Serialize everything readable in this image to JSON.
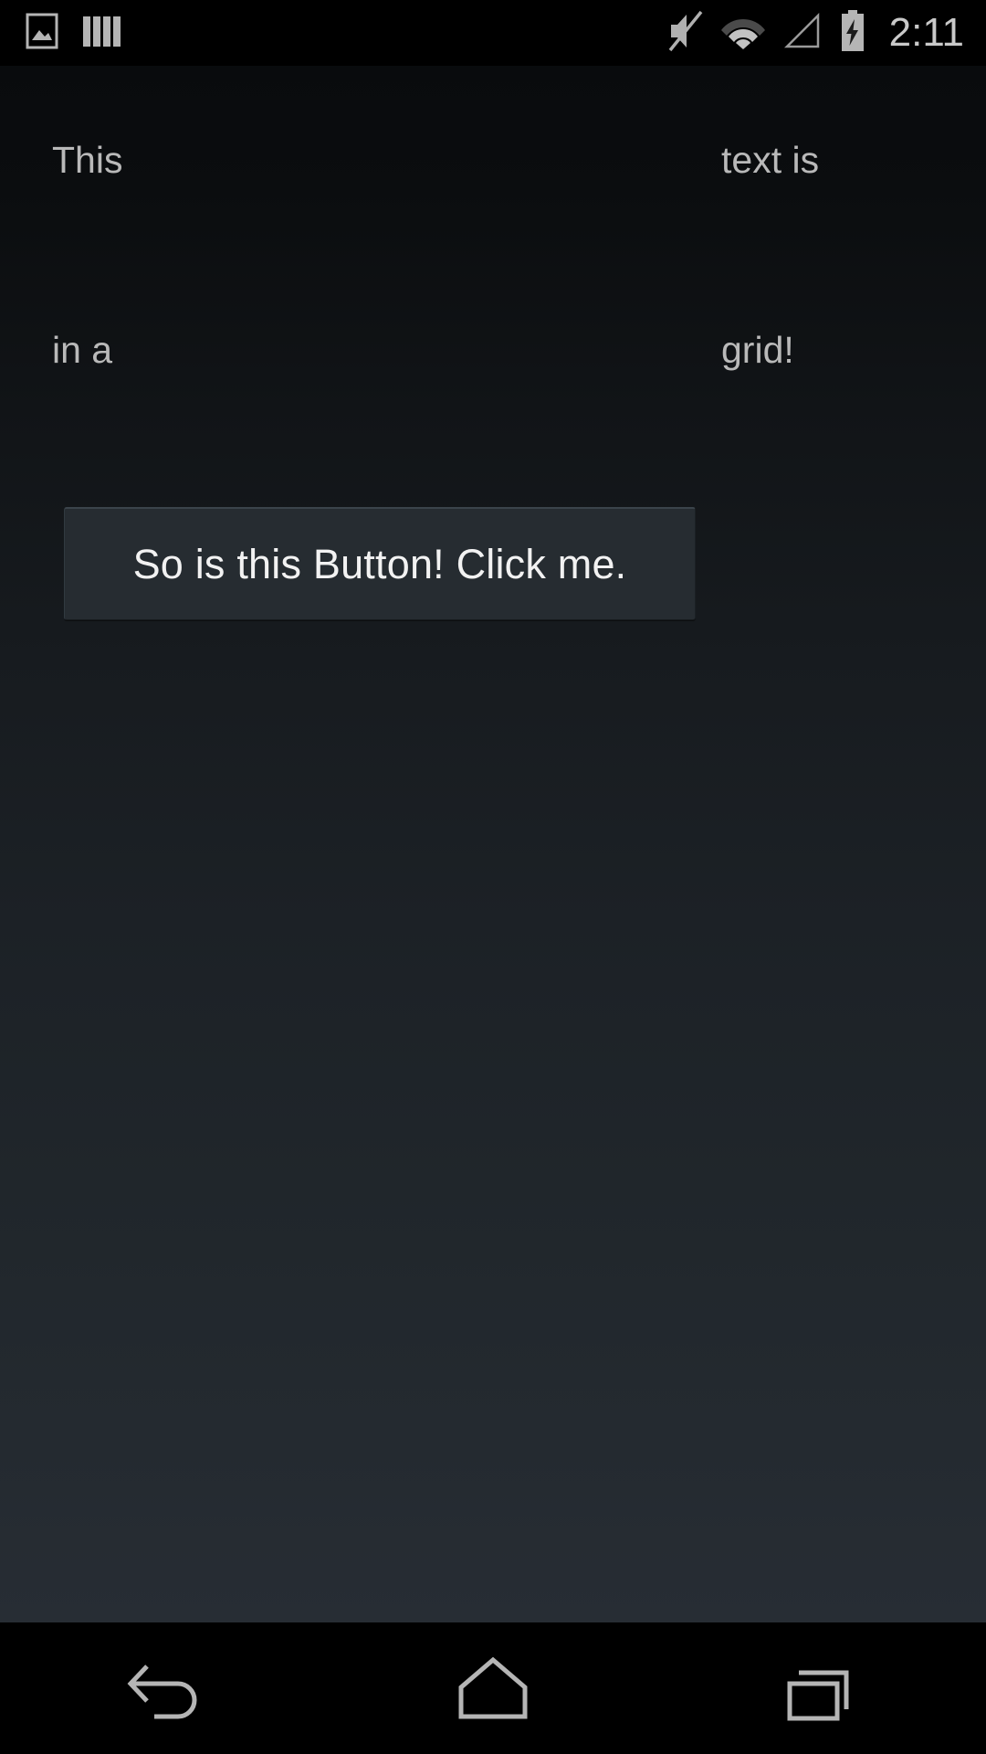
{
  "status_bar": {
    "left_icons": [
      {
        "name": "screenshot-image-icon",
        "label": "screenshot"
      },
      {
        "name": "bars-columns-icon",
        "label": "bars"
      }
    ],
    "right_icons": [
      {
        "name": "volume-mute-icon",
        "label": "silent"
      },
      {
        "name": "wifi-icon",
        "label": "wifi"
      },
      {
        "name": "cellular-signal-icon",
        "label": "no-signal"
      },
      {
        "name": "battery-charging-icon",
        "label": "charging"
      }
    ],
    "clock": "2:11"
  },
  "grid": {
    "rows": [
      {
        "cells": [
          "This",
          "text is"
        ]
      },
      {
        "cells": [
          "in a",
          "grid!"
        ]
      }
    ]
  },
  "button": {
    "label": "So is this Button! Click me."
  },
  "nav_bar": {
    "buttons": [
      {
        "name": "nav-back-button",
        "label": "Back"
      },
      {
        "name": "nav-home-button",
        "label": "Home"
      },
      {
        "name": "nav-recents-button",
        "label": "Recent apps"
      }
    ]
  },
  "colors": {
    "status_bar_bg": "#000000",
    "nav_bar_bg": "#000000",
    "content_top": "#090b0d",
    "content_bottom": "#272d34",
    "button_bg": "#262c31",
    "text_color": "#b9b9b9",
    "button_text_color": "#f2f2f2",
    "icon_color": "#b0b0b0"
  }
}
